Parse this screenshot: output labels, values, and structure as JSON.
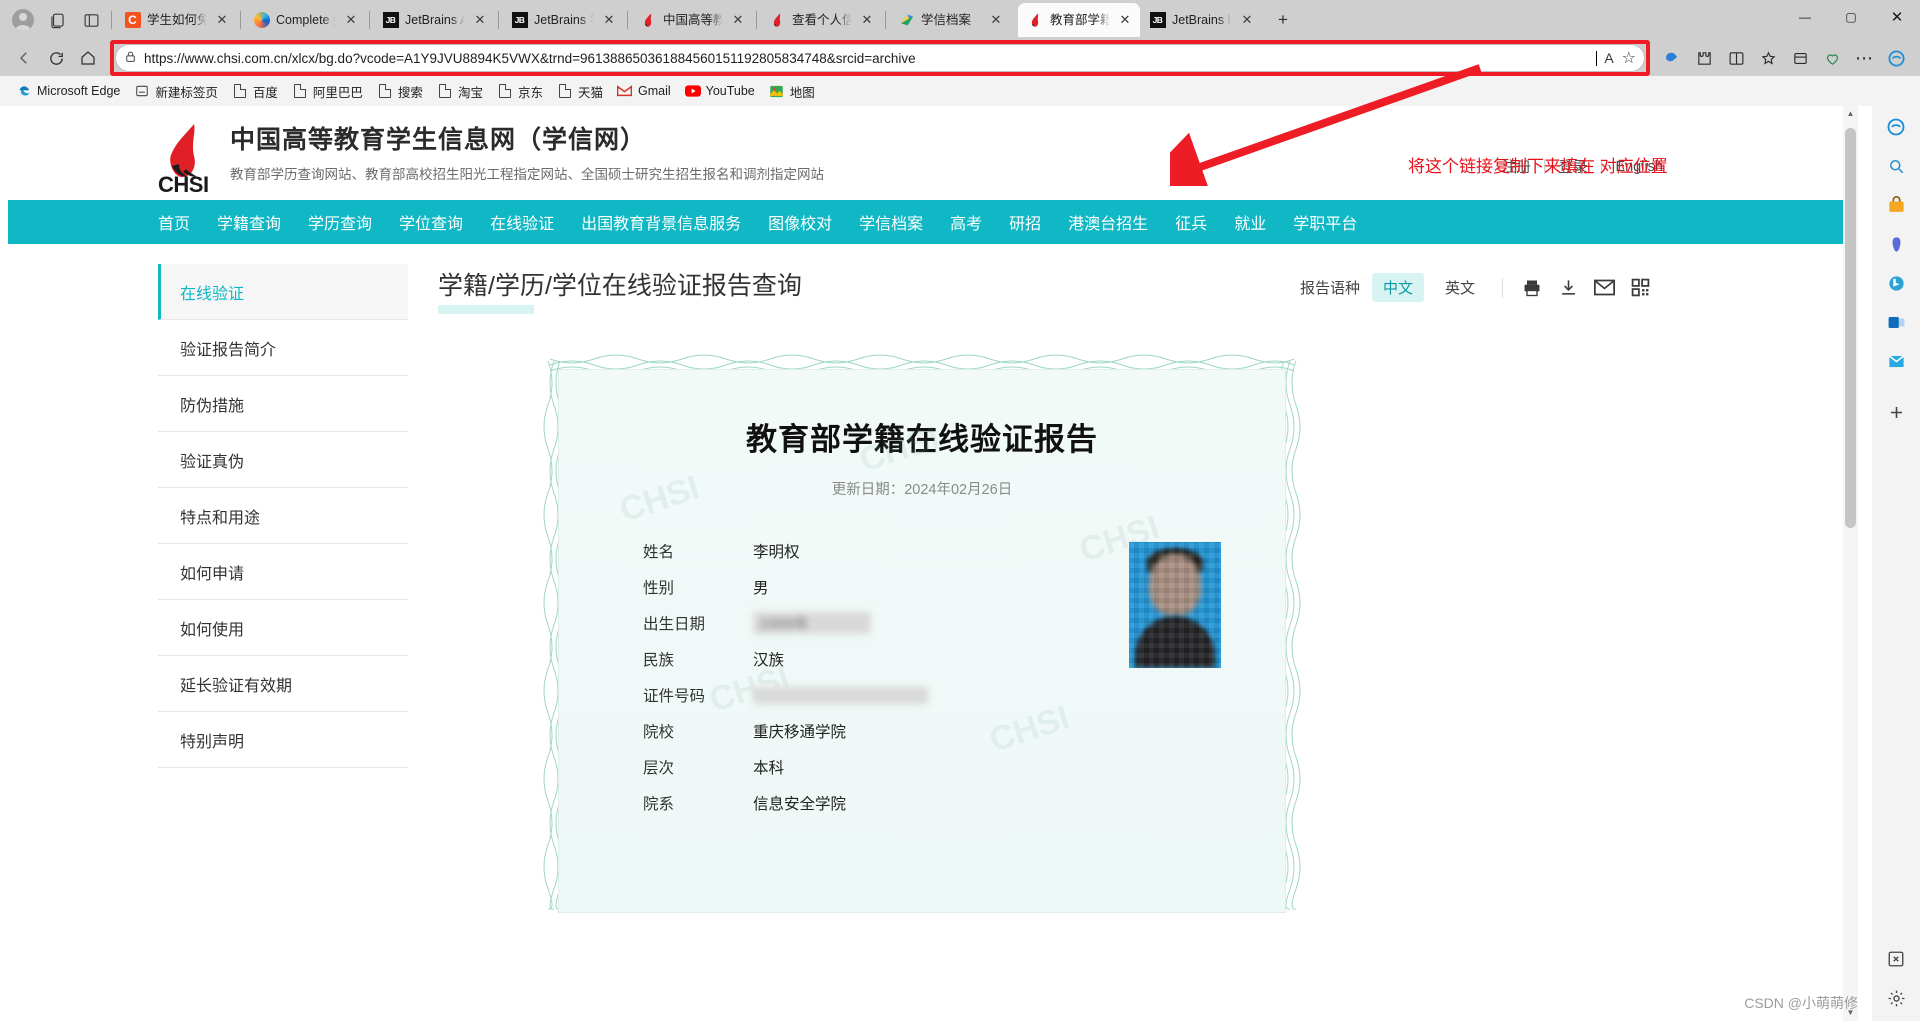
{
  "browser": {
    "tabs": [
      {
        "title": "学生如何免费",
        "favicon": "csdn-c-icon",
        "active": false
      },
      {
        "title": "Complete yo",
        "favicon": "firefox-icon",
        "active": false
      },
      {
        "title": "JetBrains Acc",
        "favicon": "jetbrains-icon",
        "active": false
      },
      {
        "title": "JetBrains 学习",
        "favicon": "jetbrains-icon",
        "active": false
      },
      {
        "title": "中国高等教育",
        "favicon": "chsi-icon",
        "active": false
      },
      {
        "title": "查看个人信息",
        "favicon": "chsi-icon",
        "active": false
      },
      {
        "title": "学信档案",
        "favicon": "green-doc-icon",
        "active": false
      },
      {
        "title": "教育部学籍在",
        "favicon": "chsi-icon",
        "active": true
      },
      {
        "title": "JetBrains lea",
        "favicon": "jetbrains-icon",
        "active": false
      }
    ],
    "new_tab_label": "+",
    "window_controls": {
      "minimize": "—",
      "maximize": "▢",
      "close": "✕"
    },
    "toolbar": {
      "back": "←",
      "refresh": "⟳",
      "home": "⌂",
      "lock_icon": "lock-icon",
      "url": "https://www.chsi.com.cn/xlcx/bg.do?vcode=A1Y9JVU8894K5VWX&trnd=961388650361884560151192805834748&srcid=archive",
      "read_aloud": "A᷈",
      "favorite": "☆",
      "split_screen": "◫",
      "collections": "⊞",
      "browser_essentials": "♡",
      "settings_more": "⋯",
      "copilot": "C"
    },
    "bookmarks": [
      {
        "label": "Microsoft Edge",
        "icon": "edge-icon"
      },
      {
        "label": "新建标签页",
        "icon": "newtab-icon"
      },
      {
        "label": "百度",
        "icon": "page-icon"
      },
      {
        "label": "阿里巴巴",
        "icon": "page-icon"
      },
      {
        "label": "搜索",
        "icon": "page-icon"
      },
      {
        "label": "淘宝",
        "icon": "page-icon"
      },
      {
        "label": "京东",
        "icon": "page-icon"
      },
      {
        "label": "天猫",
        "icon": "page-icon"
      },
      {
        "label": "Gmail",
        "icon": "gmail-icon"
      },
      {
        "label": "YouTube",
        "icon": "youtube-icon"
      },
      {
        "label": "地图",
        "icon": "maps-icon"
      }
    ]
  },
  "annotation": {
    "text": "将这个链接复制下来填在 对应位置",
    "color": "#e8111b"
  },
  "site": {
    "logo_word": "CHSI",
    "title": "中国高等教育学生信息网（学信网）",
    "subtitle": "教育部学历查询网站、教育部高校招生阳光工程指定网站、全国硕士研究生招生报名和调剂指定网站",
    "header_links": [
      "注册",
      "登录",
      "English"
    ],
    "nav": [
      "首页",
      "学籍查询",
      "学历查询",
      "学位查询",
      "在线验证",
      "出国教育背景信息服务",
      "图像校对",
      "学信档案",
      "高考",
      "研招",
      "港澳台招生",
      "征兵",
      "就业",
      "学职平台"
    ]
  },
  "sidebar": {
    "items": [
      {
        "label": "在线验证",
        "active": true
      },
      {
        "label": "验证报告简介",
        "active": false
      },
      {
        "label": "防伪措施",
        "active": false
      },
      {
        "label": "验证真伪",
        "active": false
      },
      {
        "label": "特点和用途",
        "active": false
      },
      {
        "label": "如何申请",
        "active": false
      },
      {
        "label": "如何使用",
        "active": false
      },
      {
        "label": "延长验证有效期",
        "active": false
      },
      {
        "label": "特别声明",
        "active": false
      }
    ]
  },
  "main": {
    "title": "学籍/学历/学位在线验证报告查询",
    "lang_label": "报告语种",
    "lang_options": [
      {
        "label": "中文",
        "selected": true
      },
      {
        "label": "英文",
        "selected": false
      }
    ],
    "tools": [
      {
        "name": "print-icon",
        "glyph": "🖶"
      },
      {
        "name": "download-icon",
        "glyph": "⤓"
      },
      {
        "name": "email-icon",
        "glyph": "✉"
      },
      {
        "name": "qrcode-icon",
        "glyph": "▦"
      }
    ]
  },
  "certificate": {
    "title": "教育部学籍在线验证报告",
    "update_label": "更新日期：",
    "update_date": "2024年02月26日",
    "watermark": "CHSI",
    "rows": [
      {
        "key": "姓名",
        "value": "李明权",
        "blurred": false
      },
      {
        "key": "性别",
        "value": "男",
        "blurred": false
      },
      {
        "key": "出生日期",
        "value": "1999年",
        "blurred": true
      },
      {
        "key": "民族",
        "value": "汉族",
        "blurred": false
      },
      {
        "key": "证件号码",
        "value": "",
        "blurred": true
      },
      {
        "key": "院校",
        "value": "重庆移通学院",
        "blurred": false
      },
      {
        "key": "层次",
        "value": "本科",
        "blurred": false
      },
      {
        "key": "院系",
        "value": "信息安全学院",
        "blurred": false
      }
    ],
    "photo_alt": "student-photo"
  },
  "footer": {
    "watermark": "CSDN @小萌萌修"
  }
}
